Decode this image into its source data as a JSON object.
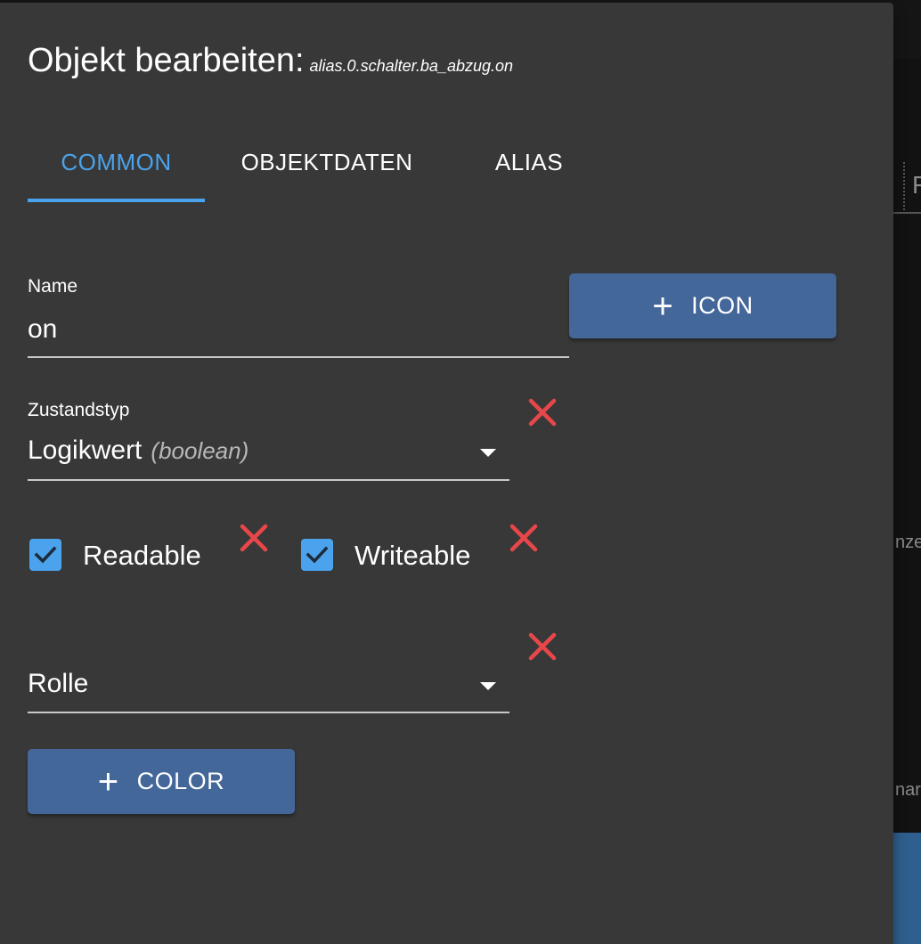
{
  "dialog": {
    "title": "Objekt bearbeiten:",
    "object_id": "alias.0.schalter.ba_abzug.on"
  },
  "tabs": [
    {
      "label": "COMMON",
      "active": true
    },
    {
      "label": "OBJEKTDATEN",
      "active": false
    },
    {
      "label": "ALIAS",
      "active": false
    }
  ],
  "form": {
    "name": {
      "label": "Name",
      "value": "on"
    },
    "icon_button": {
      "label": "ICON",
      "icon": "plus-icon"
    },
    "state_type": {
      "label": "Zustandstyp",
      "value": "Logikwert",
      "hint": "(boolean)"
    },
    "readable": {
      "label": "Readable",
      "checked": true
    },
    "writeable": {
      "label": "Writeable",
      "checked": true
    },
    "role": {
      "label": "Rolle",
      "value": ""
    },
    "color_button": {
      "label": "COLOR",
      "icon": "plus-icon"
    }
  },
  "background": {
    "fragments": [
      "F",
      "nze",
      "nar"
    ]
  },
  "colors": {
    "accent": "#4aa3ec",
    "button": "#44679a",
    "remove": "#e8474a",
    "dialog_bg": "#383838"
  }
}
